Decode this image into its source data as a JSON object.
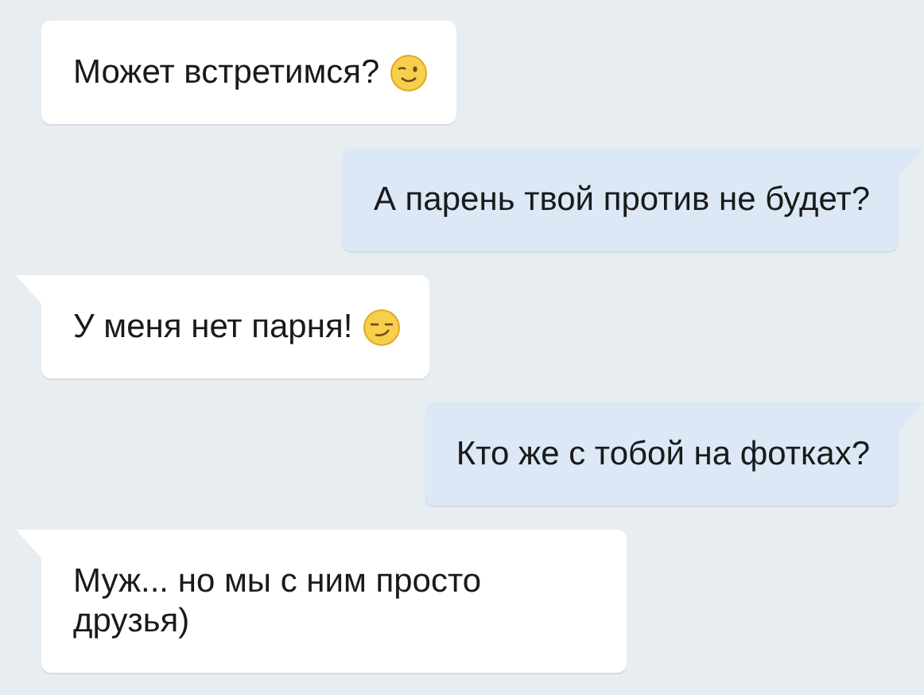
{
  "messages": [
    {
      "kind": "incoming",
      "text": "Может встретимся?",
      "emoji": {
        "kind": "wink"
      },
      "tail": false
    },
    {
      "kind": "outgoing",
      "text": "А парень твой против не будет?",
      "tail": true
    },
    {
      "kind": "incoming",
      "text": "У меня нет парня!",
      "emoji": {
        "kind": "smirk"
      },
      "tail": true
    },
    {
      "kind": "outgoing",
      "text": "Кто же с тобой на фотках?",
      "tail": true
    },
    {
      "kind": "incoming",
      "text": "Муж... но мы с ним просто друзья)",
      "tail": true
    }
  ]
}
